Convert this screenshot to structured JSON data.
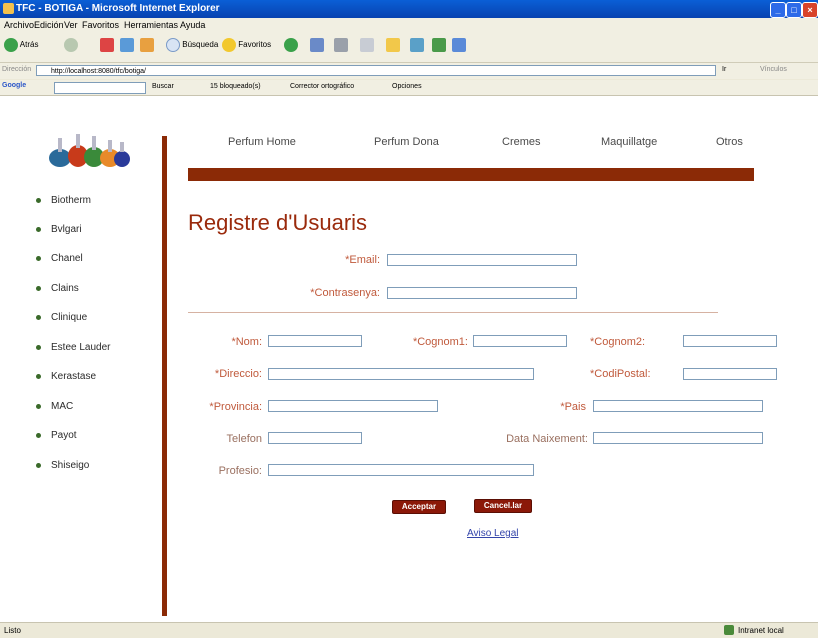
{
  "window": {
    "title": "TFC - BOTIGA - Microsoft Internet Explorer",
    "controls": [
      "_",
      "□",
      "×"
    ]
  },
  "menu": [
    "Archivo",
    "Edición",
    "Ver",
    "Favoritos",
    "Herramientas",
    "Ayuda"
  ],
  "toolbar": {
    "back": "Atrás",
    "search": "Búsqueda",
    "favorites": "Favoritos"
  },
  "address": {
    "label": "Dirección",
    "url": "http://localhost:8080/tfc/botiga/",
    "go": "Ir",
    "links": "Vínculos"
  },
  "google_bar": {
    "logo": "Google",
    "search": "Buscar",
    "blocked": "15 bloqueado(s)",
    "spell": "Corrector ortográfico",
    "options": "Opciones"
  },
  "site": {
    "nav": [
      "Perfum Home",
      "Perfum Dona",
      "Cremes",
      "Maquillatge",
      "Otros"
    ],
    "brands": [
      "Biotherm",
      "Bvlgari",
      "Chanel",
      "Clains",
      "Clinique",
      "Estee Lauder",
      "Kerastase",
      "MAC",
      "Payot",
      "Shiseigo"
    ],
    "heading": "Registre d'Usuaris",
    "form": {
      "email": "*Email:",
      "password": "*Contrasenya:",
      "nom": "*Nom:",
      "cognom1": "*Cognom1:",
      "cognom2": "*Cognom2:",
      "direccio": "*Direccio:",
      "codi_postal": "*CodiPostal:",
      "provincia": "*Provincia:",
      "pais": "*Pais",
      "telefon": "Telefon",
      "data_naixement": "Data Naixement:",
      "profesio": "Profesio:"
    },
    "buttons": {
      "accept": "Acceptar",
      "cancel": "Cancel.lar"
    },
    "legal": "Aviso Legal"
  },
  "status": {
    "left": "Listo",
    "zone": "Intranet local"
  },
  "colors": {
    "accent": "#8b2a06",
    "label": "#c05a3c",
    "heading": "#9a2a0c",
    "link": "#3344aa"
  }
}
